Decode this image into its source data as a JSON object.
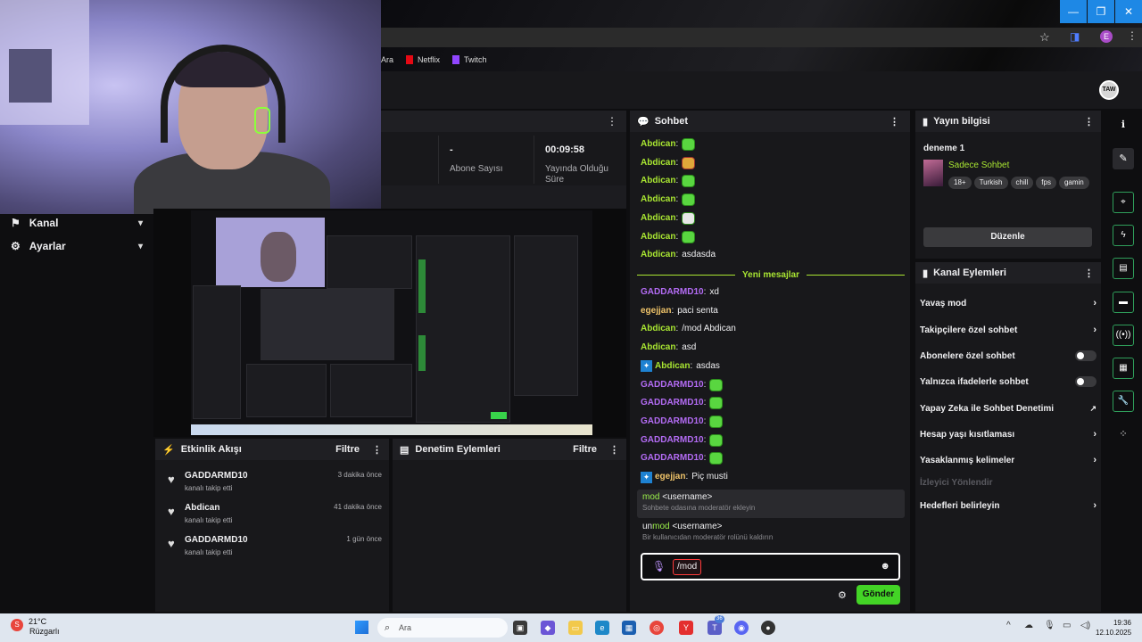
{
  "browser": {
    "bookmarks": [
      {
        "label": "Ara"
      },
      {
        "label": "Netflix"
      },
      {
        "label": "Twitch"
      }
    ],
    "profile_letter": "E",
    "window_controls": [
      "—",
      "❐",
      "✕"
    ]
  },
  "twitch": {
    "avatar_text": "TAW"
  },
  "leftnav": {
    "items": [
      {
        "label": "Kanal"
      },
      {
        "label": "Ayarlar"
      }
    ]
  },
  "stats": {
    "items": [
      {
        "value": "-",
        "label": "Abone Sayısı"
      },
      {
        "value": "00:09:58",
        "label": "Yayında Olduğu Süre"
      }
    ]
  },
  "activity": {
    "title": "Etkinlik Akışı",
    "filter_label": "Filtre",
    "events": [
      {
        "name": "GADDARMD10",
        "action": "kanalı takip etti",
        "time": "3 dakika önce"
      },
      {
        "name": "Abdican",
        "action": "kanalı takip etti",
        "time": "41 dakika önce"
      },
      {
        "name": "GADDARMD10",
        "action": "kanalı takip etti",
        "time": "1 gün önce"
      }
    ]
  },
  "moderation": {
    "title": "Denetim Eylemleri",
    "filter_label": "Filtre"
  },
  "chat": {
    "title": "Sohbet",
    "new_messages_label": "Yeni mesajlar",
    "messages_before": [
      {
        "user": "Abdican",
        "color": "#a9e632",
        "text": "",
        "emote": "green"
      },
      {
        "user": "Abdican",
        "color": "#a9e632",
        "text": "",
        "emote": "red"
      },
      {
        "user": "Abdican",
        "color": "#a9e632",
        "text": "",
        "emote": "green"
      },
      {
        "user": "Abdican",
        "color": "#a9e632",
        "text": "",
        "emote": "green"
      },
      {
        "user": "Abdican",
        "color": "#a9e632",
        "text": "",
        "emote": "bw"
      },
      {
        "user": "Abdican",
        "color": "#a9e632",
        "text": "",
        "emote": "green"
      },
      {
        "user": "Abdican",
        "color": "#a9e632",
        "text": "asdasda",
        "emote": ""
      }
    ],
    "messages_after": [
      {
        "user": "GADDARMD10",
        "color": "#b46cf5",
        "text": "xd",
        "emote": "",
        "badge": false
      },
      {
        "user": "egejjan",
        "color": "#f0c46a",
        "text": "paci senta",
        "emote": "",
        "badge": false
      },
      {
        "user": "Abdican",
        "color": "#a9e632",
        "text": "/mod Abdican",
        "emote": "",
        "badge": false
      },
      {
        "user": "Abdican",
        "color": "#a9e632",
        "text": "asd",
        "emote": "",
        "badge": false
      },
      {
        "user": "Abdican",
        "color": "#a9e632",
        "text": "asdas",
        "emote": "",
        "badge": true
      },
      {
        "user": "GADDARMD10",
        "color": "#b46cf5",
        "text": "",
        "emote": "green",
        "badge": false
      },
      {
        "user": "GADDARMD10",
        "color": "#b46cf5",
        "text": "",
        "emote": "green",
        "badge": false
      },
      {
        "user": "GADDARMD10",
        "color": "#b46cf5",
        "text": "",
        "emote": "green",
        "badge": false
      },
      {
        "user": "GADDARMD10",
        "color": "#b46cf5",
        "text": "",
        "emote": "green",
        "badge": false
      },
      {
        "user": "GADDARMD10",
        "color": "#b46cf5",
        "text": "",
        "emote": "green",
        "badge": false
      },
      {
        "user": "egejjan",
        "color": "#f0c46a",
        "text": "Piç musti",
        "emote": "",
        "badge": true
      }
    ],
    "suggestions": [
      {
        "prefix": "",
        "match": "mod",
        "rest": " <username>",
        "desc": "Sohbete odasına moderatör ekleyin"
      },
      {
        "prefix": "un",
        "match": "mod",
        "rest": " <username>",
        "desc": "Bir kullanıcıdan moderatör rolünü kaldırın"
      }
    ],
    "input_value": "/mod",
    "send_label": "Gönder"
  },
  "stream_info": {
    "title": "Yayın bilgisi",
    "stream_title": "deneme 1",
    "category": "Sadece Sohbet",
    "tags": [
      "18+",
      "Turkish",
      "chill",
      "fps",
      "gamin"
    ],
    "edit_label": "Düzenle"
  },
  "channel_actions": {
    "title": "Kanal Eylemleri",
    "items": [
      {
        "label": "Yavaş mod",
        "control": "chevron"
      },
      {
        "label": "Takipçilere özel sohbet",
        "control": "chevron"
      },
      {
        "label": "Abonelere özel sohbet",
        "control": "toggle"
      },
      {
        "label": "Yalnızca ifadelerle sohbet",
        "control": "toggle"
      },
      {
        "label": "Yapay Zeka ile Sohbet Denetimi",
        "control": "external"
      },
      {
        "label": "Hesap yaşı kısıtlaması",
        "control": "chevron"
      },
      {
        "label": "Yasaklanmış kelimeler",
        "control": "chevron"
      },
      {
        "label": "İzleyici Yönlendir",
        "control": "disabled"
      },
      {
        "label": "Hedefleri belirleyin",
        "control": "chevron"
      }
    ]
  },
  "taskbar": {
    "temperature": "21°C",
    "weather_text": "Rüzgarlı",
    "weather_badge": "S",
    "search_placeholder": "Ara",
    "teams_badge": "36",
    "time": "19:36",
    "date": "12.10.2025"
  }
}
